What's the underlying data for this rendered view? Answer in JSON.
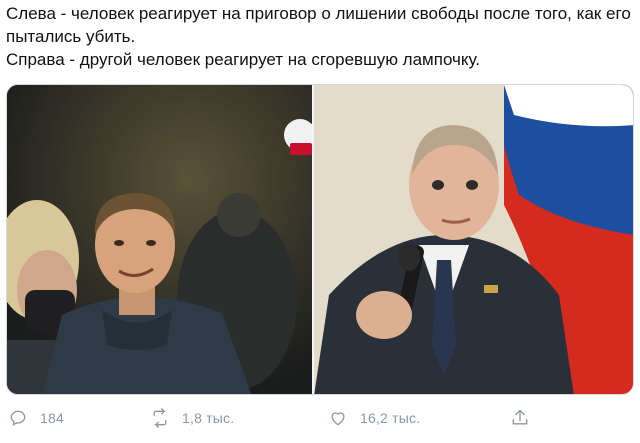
{
  "tweet": {
    "line1": "Слева - человек реагирует на приговор о лишении свободы после того, как его пытались убить.",
    "line2": "Справа - другой человек реагирует на сгоревшую лампочку."
  },
  "actions": {
    "reply_count": "184",
    "retweet_count": "1,8 тыс.",
    "like_count": "16,2 тыс."
  },
  "icons": {
    "reply": "reply-icon",
    "retweet": "retweet-icon",
    "like": "heart-icon",
    "share": "share-icon"
  },
  "colors": {
    "icon_gray": "#8b98a5",
    "text": "#111111",
    "flag_white": "#ffffff",
    "flag_blue": "#1c4fa0",
    "flag_red": "#d52b1e"
  }
}
